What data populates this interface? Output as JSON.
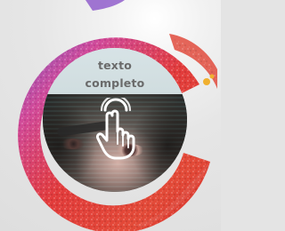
{
  "card": {
    "title_line1": "texto",
    "title_line2": "completo"
  },
  "icons": {
    "hand": "tap-hand-icon"
  },
  "colors": {
    "background": "#e4e4e4",
    "ring_red": "#e23b3b",
    "ring_pink": "#e45a9a",
    "ring_purple": "#8b55c9",
    "card_text": "#6a6a6a"
  }
}
